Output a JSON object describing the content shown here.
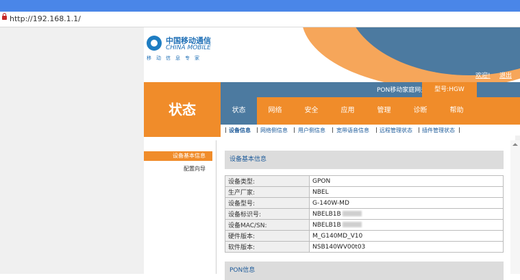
{
  "browser": {
    "url": "http://192.168.1.1/"
  },
  "header": {
    "logo_cn": "中国移动通信",
    "logo_en": "CHINA MOBILE",
    "logo_slogan": "移动信息专家",
    "links": [
      "欢迎!",
      "退出"
    ]
  },
  "brand": {
    "status_label": "状态",
    "product": "PON移动家庭网关",
    "model": "型号:HGW"
  },
  "nav": {
    "tabs": [
      "状态",
      "网络",
      "安全",
      "应用",
      "管理",
      "诊断",
      "帮助"
    ],
    "active": 0,
    "subtabs": [
      "设备信息",
      "网络侧信息",
      "用户侧信息",
      "宽带语音信息",
      "远程管理状态",
      "插件管理状态"
    ]
  },
  "sidebar": {
    "items": [
      "设备基本信息",
      "配置向导"
    ]
  },
  "sections": {
    "device": "设备基本信息",
    "pon": "PON信息"
  },
  "device_info": [
    {
      "label": "设备类型:",
      "value": "GPON"
    },
    {
      "label": "生产厂家:",
      "value": "NBEL"
    },
    {
      "label": "设备型号:",
      "value": "G-140W-MD"
    },
    {
      "label": "设备标识号:",
      "value": "NBELB1B"
    },
    {
      "label": "设备MAC/SN:",
      "value": "NBELB1B"
    },
    {
      "label": "硬件版本:",
      "value": "M_G140MD_V10"
    },
    {
      "label": "软件版本:",
      "value": "NSB140WV00t03"
    }
  ],
  "colors": {
    "orange": "#f08c2a",
    "blue": "#4c7aa0",
    "browser_blue": "#4a86e8"
  }
}
